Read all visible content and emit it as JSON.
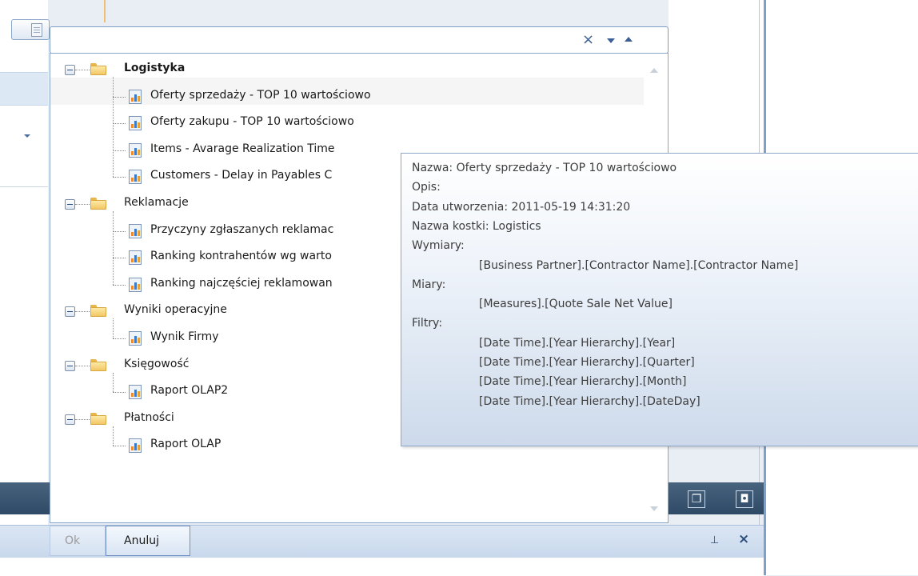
{
  "combo": {
    "value": ""
  },
  "tree": [
    {
      "folder": "Logistyka",
      "bold": true,
      "items": [
        "Oferty sprzedaży - TOP 10 wartościowo",
        "Oferty zakupu - TOP 10 wartościowo",
        "Items - Avarage Realization Time",
        "Customers - Delay in Payables C"
      ]
    },
    {
      "folder": "Reklamacje",
      "bold": false,
      "items": [
        "Przyczyny zgłaszanych reklamac",
        "Ranking kontrahentów wg warto",
        "Ranking najczęściej reklamowan"
      ]
    },
    {
      "folder": "Wyniki operacyjne",
      "bold": false,
      "items": [
        "Wynik Firmy"
      ]
    },
    {
      "folder": "Księgowość",
      "bold": false,
      "items": [
        "Raport OLAP2"
      ]
    },
    {
      "folder": "Płatności",
      "bold": false,
      "items": [
        "Raport OLAP"
      ]
    }
  ],
  "tooltip": {
    "lines": [
      "Nazwa: Oferty sprzedaży - TOP 10 wartościowo",
      "Opis:",
      "Data utworzenia: 2011-05-19 14:31:20",
      "Nazwa kostki: Logistics",
      "Wymiary:",
      "[Business Partner].[Contractor Name].[Contractor Name]",
      "Miary:",
      "[Measures].[Quote Sale Net Value]",
      "Filtry:",
      "[Date Time].[Year Hierarchy].[Year]",
      "[Date Time].[Year Hierarchy].[Quarter]",
      "[Date Time].[Year Hierarchy].[Month]",
      "[Date Time].[Year Hierarchy].[DateDay]"
    ]
  },
  "buttons": {
    "ok": "Ok",
    "cancel": "Anuluj"
  },
  "icons": {
    "clear": "close-icon",
    "dropdown": "chevron-down-icon",
    "collapse": "chevron-up-icon",
    "folder": "folder-icon",
    "report": "report-chart-icon",
    "expander": "tree-collapse-icon",
    "pin": "pin-icon",
    "close": "close-icon"
  },
  "colors": {
    "accent": "#3b5f94",
    "tooltip_bg": "#e6edf7",
    "dark_bar": "#3a556f"
  }
}
